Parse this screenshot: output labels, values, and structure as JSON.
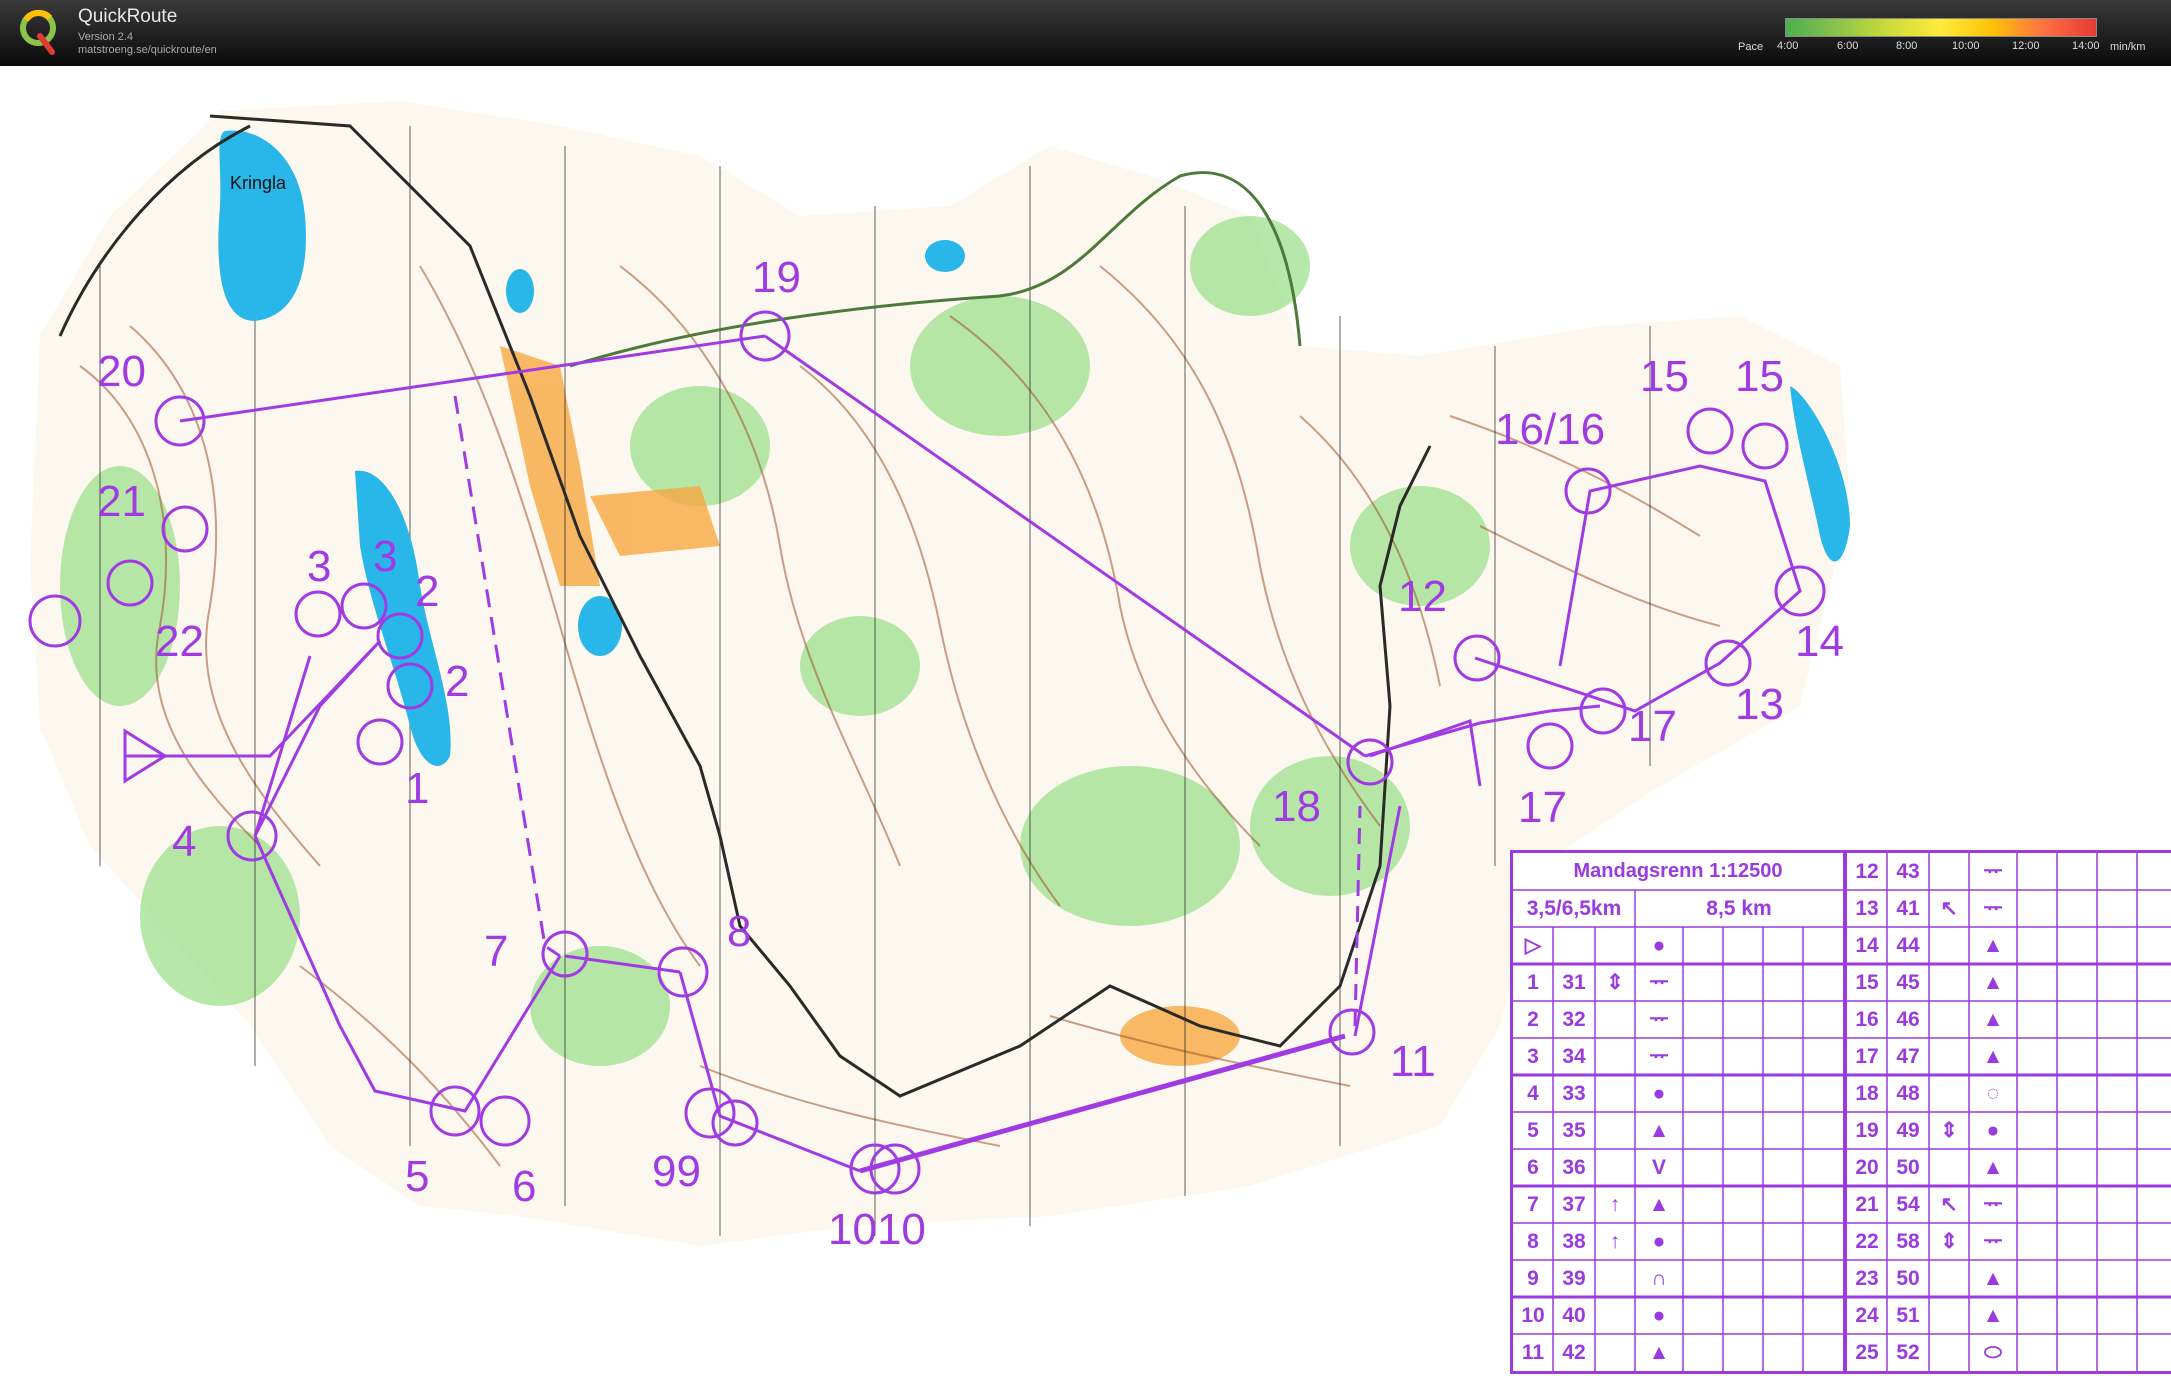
{
  "app": {
    "name": "QuickRoute",
    "version": "Version 2.4",
    "url": "matstroeng.se/quickroute/en"
  },
  "pace_scale": {
    "label": "Pace",
    "ticks": [
      "4:00",
      "6:00",
      "8:00",
      "10:00",
      "12:00",
      "14:00"
    ],
    "unit": "min/km",
    "colors": [
      "#4caf50",
      "#8bc34a",
      "#cddc39",
      "#ffeb3b",
      "#ffc107",
      "#ff7043",
      "#e53935"
    ]
  },
  "map": {
    "lake_label": "Kringla",
    "route_color": "#a03be3",
    "control_labels": [
      "19",
      "20",
      "21",
      "22",
      "3",
      "3",
      "2",
      "2",
      "1",
      "4",
      "5",
      "6",
      "7",
      "8",
      "99",
      "1010",
      "11",
      "12",
      "13",
      "14",
      "15",
      "15",
      "16/16",
      "17",
      "17",
      "18"
    ]
  },
  "description": {
    "title": "Mandagsrenn 1:12500",
    "course_a": "3,5/6,5km",
    "course_b": "8,5 km",
    "left_rows": [
      {
        "no": "1",
        "code": "31",
        "sym1": "⇕",
        "sym2": "ᅲ"
      },
      {
        "no": "2",
        "code": "32",
        "sym1": "",
        "sym2": "ᅲ"
      },
      {
        "no": "3",
        "code": "34",
        "sym1": "",
        "sym2": "ᅲ"
      },
      {
        "no": "4",
        "code": "33",
        "sym1": "",
        "sym2": "●"
      },
      {
        "no": "5",
        "code": "35",
        "sym1": "",
        "sym2": "▲"
      },
      {
        "no": "6",
        "code": "36",
        "sym1": "",
        "sym2": "V"
      },
      {
        "no": "7",
        "code": "37",
        "sym1": "↑",
        "sym2": "▲"
      },
      {
        "no": "8",
        "code": "38",
        "sym1": "↑",
        "sym2": "●"
      },
      {
        "no": "9",
        "code": "39",
        "sym1": "",
        "sym2": "∩"
      },
      {
        "no": "10",
        "code": "40",
        "sym1": "",
        "sym2": "●"
      },
      {
        "no": "11",
        "code": "42",
        "sym1": "",
        "sym2": "▲"
      }
    ],
    "right_rows": [
      {
        "no": "12",
        "code": "43",
        "sym1": "",
        "sym2": "ᅲ"
      },
      {
        "no": "13",
        "code": "41",
        "sym1": "↖",
        "sym2": "ᅲ"
      },
      {
        "no": "14",
        "code": "44",
        "sym1": "",
        "sym2": "▲"
      },
      {
        "no": "15",
        "code": "45",
        "sym1": "",
        "sym2": "▲"
      },
      {
        "no": "16",
        "code": "46",
        "sym1": "",
        "sym2": "▲"
      },
      {
        "no": "17",
        "code": "47",
        "sym1": "",
        "sym2": "▲"
      },
      {
        "no": "18",
        "code": "48",
        "sym1": "",
        "sym2": "◌"
      },
      {
        "no": "19",
        "code": "49",
        "sym1": "⇕",
        "sym2": "●"
      },
      {
        "no": "20",
        "code": "50",
        "sym1": "",
        "sym2": "▲"
      },
      {
        "no": "21",
        "code": "54",
        "sym1": "↖",
        "sym2": "ᅲ"
      },
      {
        "no": "22",
        "code": "58",
        "sym1": "⇕",
        "sym2": "ᅲ"
      },
      {
        "no": "23",
        "code": "50",
        "sym1": "",
        "sym2": "▲"
      },
      {
        "no": "24",
        "code": "51",
        "sym1": "",
        "sym2": "▲"
      },
      {
        "no": "25",
        "code": "52",
        "sym1": "",
        "sym2": "⬭"
      }
    ],
    "start_symbol": "▷",
    "start_sym2": "●"
  }
}
